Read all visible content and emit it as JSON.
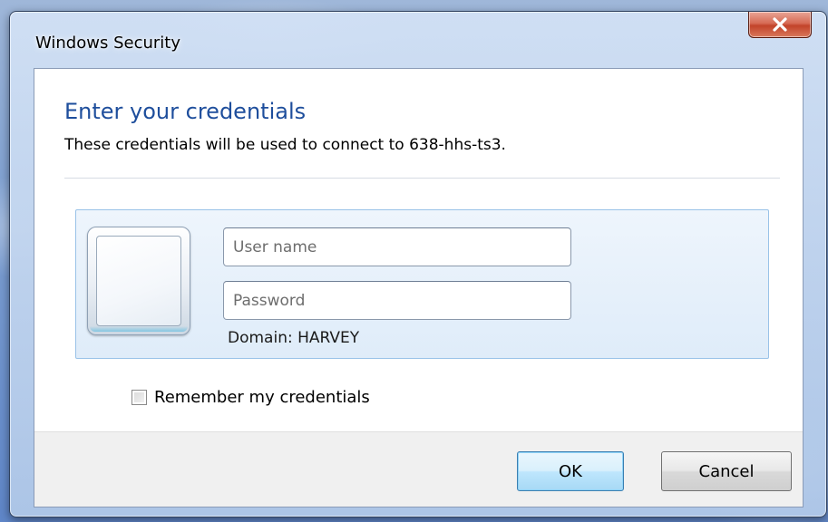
{
  "window": {
    "title": "Windows Security",
    "close_glyph": "✕"
  },
  "content": {
    "heading": "Enter your credentials",
    "description": "These credentials will be used to connect to 638-hhs-ts3."
  },
  "credentials": {
    "username_placeholder": "User name",
    "username_value": "",
    "password_placeholder": "Password",
    "password_value": "",
    "domain_label": "Domain: HARVEY",
    "user_tile_icon": "user-picture-frame"
  },
  "remember": {
    "label": "Remember my credentials",
    "checked": false
  },
  "buttons": {
    "ok_label": "OK",
    "cancel_label": "Cancel"
  },
  "colors": {
    "heading": "#1e4e9c",
    "tile_border": "#99c2e8",
    "close_button": "#c2432a"
  }
}
